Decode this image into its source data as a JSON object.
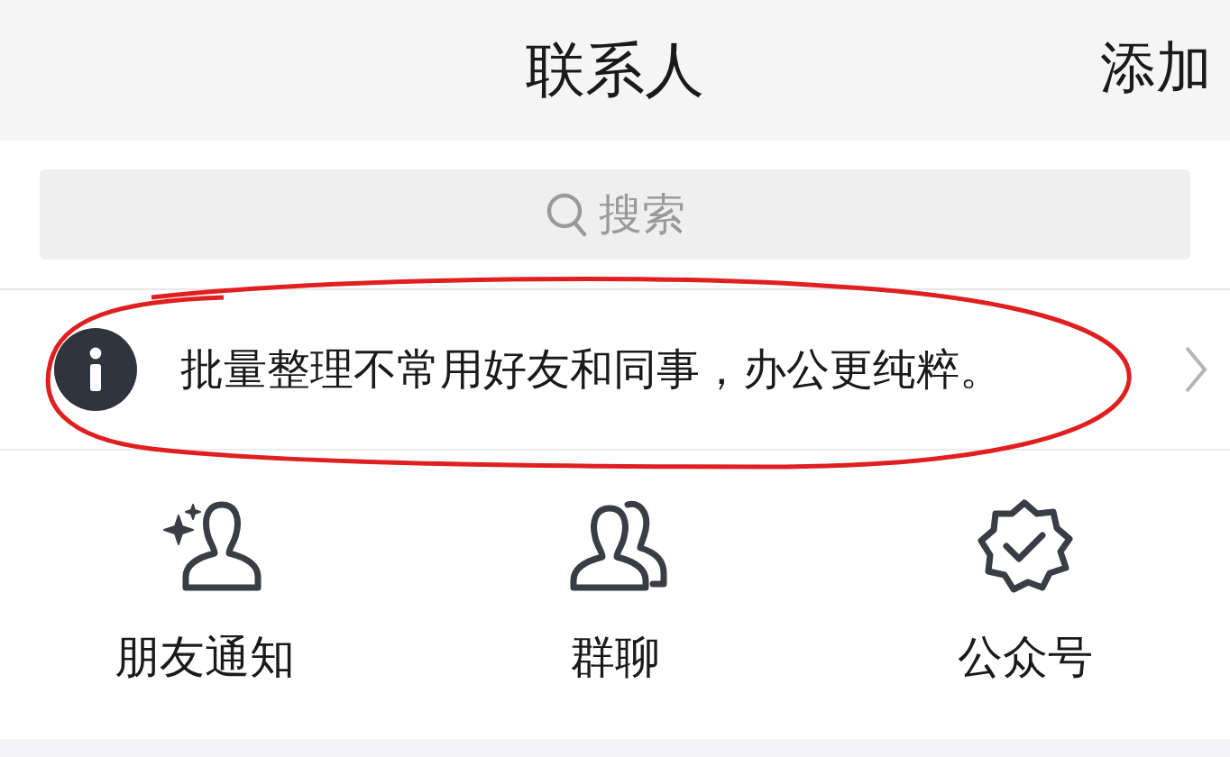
{
  "header": {
    "title": "联系人",
    "action": "添加"
  },
  "search": {
    "placeholder": "搜索"
  },
  "notice": {
    "text": "批量整理不常用好友和同事，办公更纯粹。"
  },
  "shortcuts": [
    {
      "kind": "friend",
      "label": "朋友通知"
    },
    {
      "kind": "group",
      "label": "群聊"
    },
    {
      "kind": "official",
      "label": "公众号"
    }
  ]
}
